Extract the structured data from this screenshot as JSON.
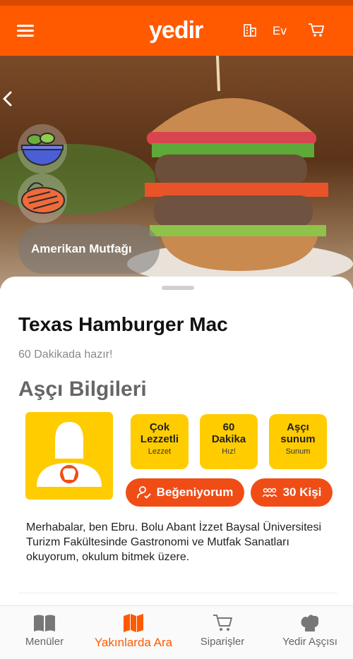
{
  "header": {
    "logo": "yedir",
    "location": "Ev"
  },
  "hero": {
    "cuisine": "Amerikan Mutfağı"
  },
  "recipe": {
    "title": "Texas Hamburger Mac",
    "ready_text": "60 Dakikada hazır!"
  },
  "chef": {
    "section_title": "Aşçı Bilgileri",
    "stats": [
      {
        "big_line1": "Çok",
        "big_line2": "Lezzetli",
        "small": "Lezzet"
      },
      {
        "big_line1": "60",
        "big_line2": "Dakika",
        "small": "Hız!"
      },
      {
        "big_line1": "Aşçı",
        "big_line2": "sunum",
        "small": "Sunum"
      }
    ],
    "like_label": "Beğeniyorum",
    "people_label": "30 Kişi",
    "bio": "Merhabalar, ben Ebru. Bolu Abant İzzet Baysal Üniversitesi Turizm Fakültesinde Gastronomi ve Mutfak Sanatları okuyorum, okulum bitmek üzere."
  },
  "nav": {
    "items": [
      {
        "label": "Menüler"
      },
      {
        "label": "Yakınlarda Ara"
      },
      {
        "label": "Siparişler"
      },
      {
        "label": "Yedir Aşçısı"
      }
    ]
  },
  "colors": {
    "primary": "#ff5a00",
    "accent": "#ffcc00",
    "button": "#f04d16"
  }
}
